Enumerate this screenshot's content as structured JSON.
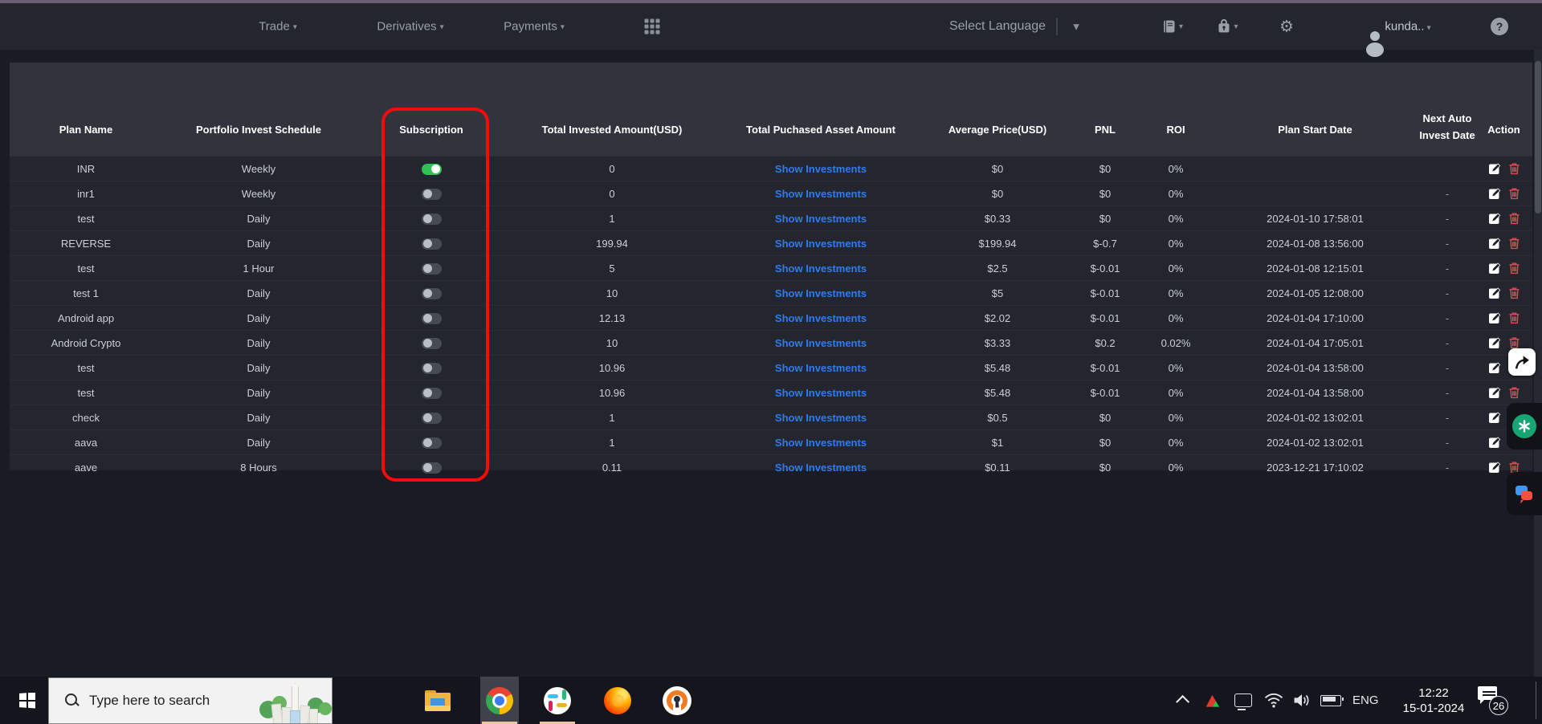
{
  "nav": {
    "items": [
      {
        "label": "Trade"
      },
      {
        "label": "Derivatives"
      },
      {
        "label": "Payments"
      }
    ],
    "select_language": "Select Language",
    "username": "kunda..",
    "help_glyph": "?"
  },
  "icons": {
    "apps-grid-icon": "3x3 squares",
    "book-icon": "ledger book",
    "wallet-icon": "padlock wallet",
    "gear-icon": "⚙",
    "avatar": "person silhouette",
    "help-icon": "? in circle",
    "edit-icon": "white pen square",
    "trash-icon": "red trash can",
    "share-icon": "curved arrow",
    "chatgpt-icon": "white knot on green circle",
    "chat-bubbles-icon": "blue+red bubbles",
    "windows-start-icon": "4 panes",
    "search-icon": "magnifier"
  },
  "table": {
    "headers": [
      "Plan Name",
      "Portfolio Invest Schedule",
      "Subscription",
      "Total Invested Amount(USD)",
      "Total Puchased Asset Amount",
      "Average Price(USD)",
      "PNL",
      "ROI",
      "Plan Start Date",
      "Next Auto Invest Date",
      "Action"
    ],
    "show_investments_label": "Show Investments",
    "rows": [
      {
        "plan_name": "INR",
        "schedule": "Weekly",
        "subscription_on": true,
        "total_invested": "0",
        "avg_price": "$0",
        "pnl": "$0",
        "roi": "0%",
        "start_date": "",
        "next_date": ""
      },
      {
        "plan_name": "inr1",
        "schedule": "Weekly",
        "subscription_on": false,
        "total_invested": "0",
        "avg_price": "$0",
        "pnl": "$0",
        "roi": "0%",
        "start_date": "",
        "next_date": "-"
      },
      {
        "plan_name": "test",
        "schedule": "Daily",
        "subscription_on": false,
        "total_invested": "1",
        "avg_price": "$0.33",
        "pnl": "$0",
        "roi": "0%",
        "start_date": "2024-01-10 17:58:01",
        "next_date": "-"
      },
      {
        "plan_name": "REVERSE",
        "schedule": "Daily",
        "subscription_on": false,
        "total_invested": "199.94",
        "avg_price": "$199.94",
        "pnl": "$-0.7",
        "roi": "0%",
        "start_date": "2024-01-08 13:56:00",
        "next_date": "-"
      },
      {
        "plan_name": "test",
        "schedule": "1 Hour",
        "subscription_on": false,
        "total_invested": "5",
        "avg_price": "$2.5",
        "pnl": "$-0.01",
        "roi": "0%",
        "start_date": "2024-01-08 12:15:01",
        "next_date": "-"
      },
      {
        "plan_name": "test 1",
        "schedule": "Daily",
        "subscription_on": false,
        "total_invested": "10",
        "avg_price": "$5",
        "pnl": "$-0.01",
        "roi": "0%",
        "start_date": "2024-01-05 12:08:00",
        "next_date": "-"
      },
      {
        "plan_name": "Android app",
        "schedule": "Daily",
        "subscription_on": false,
        "total_invested": "12.13",
        "avg_price": "$2.02",
        "pnl": "$-0.01",
        "roi": "0%",
        "start_date": "2024-01-04 17:10:00",
        "next_date": "-"
      },
      {
        "plan_name": "Android Crypto",
        "schedule": "Daily",
        "subscription_on": false,
        "total_invested": "10",
        "avg_price": "$3.33",
        "pnl": "$0.2",
        "roi": "0.02%",
        "start_date": "2024-01-04 17:05:01",
        "next_date": "-"
      },
      {
        "plan_name": "test",
        "schedule": "Daily",
        "subscription_on": false,
        "total_invested": "10.96",
        "avg_price": "$5.48",
        "pnl": "$-0.01",
        "roi": "0%",
        "start_date": "2024-01-04 13:58:00",
        "next_date": "-"
      },
      {
        "plan_name": "test",
        "schedule": "Daily",
        "subscription_on": false,
        "total_invested": "10.96",
        "avg_price": "$5.48",
        "pnl": "$-0.01",
        "roi": "0%",
        "start_date": "2024-01-04 13:58:00",
        "next_date": "-"
      },
      {
        "plan_name": "check",
        "schedule": "Daily",
        "subscription_on": false,
        "total_invested": "1",
        "avg_price": "$0.5",
        "pnl": "$0",
        "roi": "0%",
        "start_date": "2024-01-02 13:02:01",
        "next_date": "-"
      },
      {
        "plan_name": "aava",
        "schedule": "Daily",
        "subscription_on": false,
        "total_invested": "1",
        "avg_price": "$1",
        "pnl": "$0",
        "roi": "0%",
        "start_date": "2024-01-02 13:02:01",
        "next_date": "-"
      },
      {
        "plan_name": "aave",
        "schedule": "8 Hours",
        "subscription_on": false,
        "total_invested": "0.11",
        "avg_price": "$0.11",
        "pnl": "$0",
        "roi": "0%",
        "start_date": "2023-12-21 17:10:02",
        "next_date": "-"
      }
    ]
  },
  "taskbar": {
    "search_placeholder": "Type here to search",
    "language_badge": "ENG",
    "time": "12:22",
    "date": "15-01-2024",
    "notification_count": "26"
  },
  "colors": {
    "highlight_red": "#f40b0b",
    "toggle_on_green": "#2fc154",
    "link_blue": "#2e7bf6",
    "trash_red": "#e04a52",
    "taskbar_underline": "#f2c29c",
    "topline_purple": "#6a5d6f",
    "nav_bg": "#23262e",
    "table_header_bg": "#31343d",
    "row_bg": "#23262e"
  }
}
